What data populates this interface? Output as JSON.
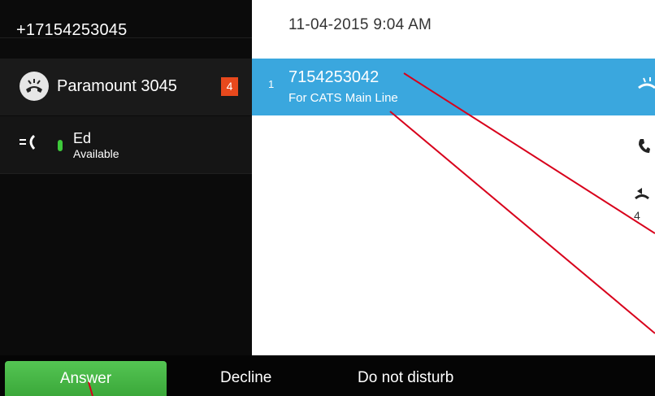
{
  "sidebar": {
    "header_number": "+17154253045",
    "lines": [
      {
        "label": "Paramount 3045",
        "badge": "4"
      },
      {
        "name": "Ed",
        "status": "Available",
        "status_color": "#3ec93b"
      }
    ]
  },
  "main": {
    "datetime": "11-04-2015 9:04 AM",
    "active_call": {
      "index": "1",
      "number": "7154253042",
      "subtitle": "For CATS Main Line"
    },
    "side_count": "4"
  },
  "softkeys": {
    "answer": "Answer",
    "decline": "Decline",
    "dnd": "Do not disturb"
  },
  "colors": {
    "accent": "#3aa7de",
    "answer": "#4bba4a",
    "badge": "#e8491d",
    "annotation": "#d8001b"
  },
  "icons": [
    "incoming-call-icon",
    "call-forward-icon",
    "phone-icon",
    "call-back-icon"
  ]
}
